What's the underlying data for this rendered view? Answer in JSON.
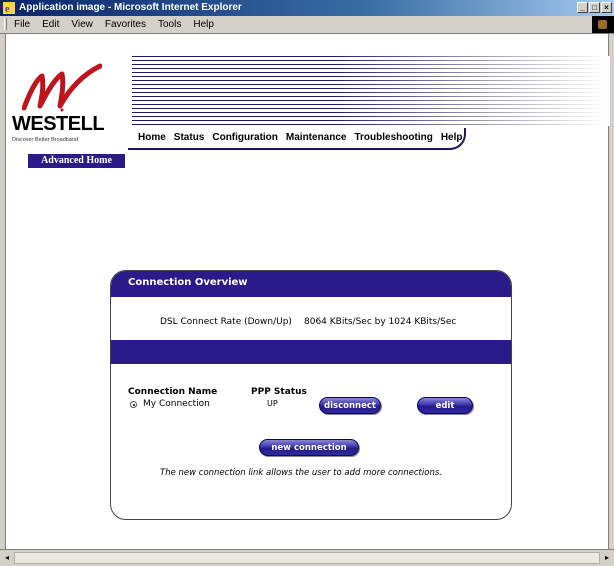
{
  "window": {
    "title": "Application image - Microsoft Internet Explorer",
    "controls": [
      "_",
      "□",
      "×"
    ]
  },
  "menubar": {
    "items": [
      "File",
      "Edit",
      "View",
      "Favorites",
      "Tools",
      "Help"
    ]
  },
  "header": {
    "logo_text": "WESTELL",
    "tagline": "Discover Better Broadband",
    "nav": [
      "Home",
      "Status",
      "Configuration",
      "Maintenance",
      "Troubleshooting",
      "Help"
    ],
    "section_label": "Advanced Home"
  },
  "panel": {
    "title": "Connection Overview",
    "dsl_rate_label": "DSL Connect Rate (Down/Up)",
    "dsl_rate_value": "8064 KBits/Sec by 1024 KBits/Sec",
    "column_connection_name": "Connection Name",
    "column_ppp_status": "PPP Status",
    "connection": {
      "name": "My Connection",
      "status": "UP",
      "selected": true
    },
    "buttons": {
      "disconnect": "disconnect",
      "edit": "edit",
      "new_connection": "new connection"
    },
    "note": "The new connection link allows the user to add more connections."
  },
  "colors": {
    "brand_purple": "#2b1a8a",
    "brand_red": "#c0141c",
    "titlebar_blue": "#0a246a"
  },
  "scrollbar": {
    "left_arrow": "◂",
    "right_arrow": "▸"
  }
}
